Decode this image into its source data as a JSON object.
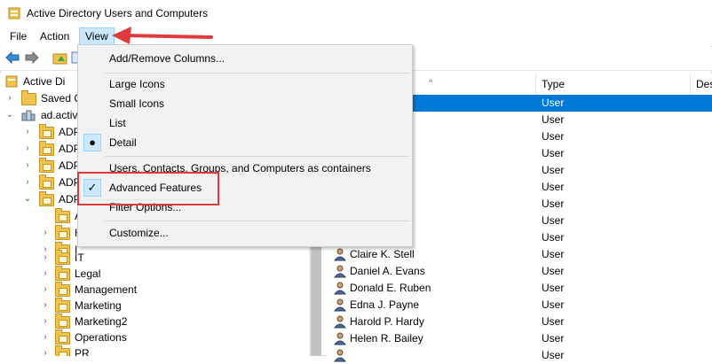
{
  "window": {
    "title": "Active Directory Users and Computers",
    "icon": "ad-folder-icon"
  },
  "menubar": {
    "items": [
      "File",
      "Action",
      "View"
    ],
    "active": "View"
  },
  "toolbar": {
    "icons": [
      "back-icon",
      "forward-icon",
      "up-folder-icon",
      "console-tree-icon"
    ]
  },
  "tree": {
    "items": [
      {
        "label": "Active Directory Users and Computers",
        "visible_text": "Active Di",
        "indent": 0,
        "chevron": ""
      },
      {
        "label": "Saved Q",
        "indent": 1,
        "chevron": ">"
      },
      {
        "label": "ad.activ",
        "indent": 1,
        "chevron": "v"
      },
      {
        "label": "ADP",
        "indent": 2,
        "chevron": ">"
      },
      {
        "label": "ADP",
        "indent": 2,
        "chevron": ">"
      },
      {
        "label": "ADP",
        "indent": 2,
        "chevron": ">"
      },
      {
        "label": "ADP",
        "indent": 2,
        "chevron": ">"
      },
      {
        "label": "ADP",
        "indent": 2,
        "chevron": "v"
      },
      {
        "label": "A",
        "indent": 3,
        "chevron": ""
      },
      {
        "label": "H",
        "indent": 3,
        "chevron": ">"
      },
      {
        "label": "I",
        "indent": 3,
        "chevron": ">"
      },
      {
        "label": "IT",
        "indent": 3,
        "chevron": ">"
      },
      {
        "label": "Legal",
        "indent": 3,
        "chevron": ">"
      },
      {
        "label": "Management",
        "indent": 3,
        "chevron": ">"
      },
      {
        "label": "Marketing",
        "indent": 3,
        "chevron": ">"
      },
      {
        "label": "Marketing2",
        "indent": 3,
        "chevron": ">"
      },
      {
        "label": "Operations",
        "indent": 3,
        "chevron": ">"
      },
      {
        "label": "PR",
        "indent": 3,
        "chevron": ">"
      }
    ]
  },
  "list": {
    "columns": [
      {
        "label": ""
      },
      {
        "label": "Type"
      },
      {
        "label": "Des"
      }
    ],
    "rows": [
      {
        "name": "",
        "type": "User",
        "selected": true
      },
      {
        "name": "ory",
        "type": "User"
      },
      {
        "name": "navides",
        "type": "User"
      },
      {
        "name": "",
        "type": "User"
      },
      {
        "name": "nolds",
        "type": "User"
      },
      {
        "name": "mmond",
        "type": "User"
      },
      {
        "name": "ts",
        "type": "User"
      },
      {
        "name": "azier",
        "type": "User"
      },
      {
        "name": "S. Monk",
        "type": "User"
      },
      {
        "name": "Claire K. Stell",
        "type": "User"
      },
      {
        "name": "Daniel A. Evans",
        "type": "User"
      },
      {
        "name": "Donald E. Ruben",
        "type": "User"
      },
      {
        "name": "Edna J. Payne",
        "type": "User"
      },
      {
        "name": "Harold P. Hardy",
        "type": "User"
      },
      {
        "name": "Helen R. Bailey",
        "type": "User"
      },
      {
        "name": "",
        "type": "User"
      }
    ]
  },
  "view_menu": {
    "items": [
      {
        "label": "Add/Remove Columns...",
        "mark": ""
      },
      {
        "separator": true
      },
      {
        "label": "Large Icons",
        "mark": ""
      },
      {
        "label": "Small Icons",
        "mark": ""
      },
      {
        "label": "List",
        "mark": ""
      },
      {
        "label": "Detail",
        "mark": "bullet"
      },
      {
        "separator": true
      },
      {
        "label": "Users, Contacts, Groups, and Computers as containers",
        "mark": ""
      },
      {
        "label": "Advanced Features",
        "mark": "check"
      },
      {
        "label": "Filter Options...",
        "mark": ""
      },
      {
        "separator": true
      },
      {
        "label": "Customize...",
        "mark": ""
      }
    ]
  },
  "annotation": {
    "color": "#e03a3a",
    "highlighted_item": "Advanced Features"
  }
}
